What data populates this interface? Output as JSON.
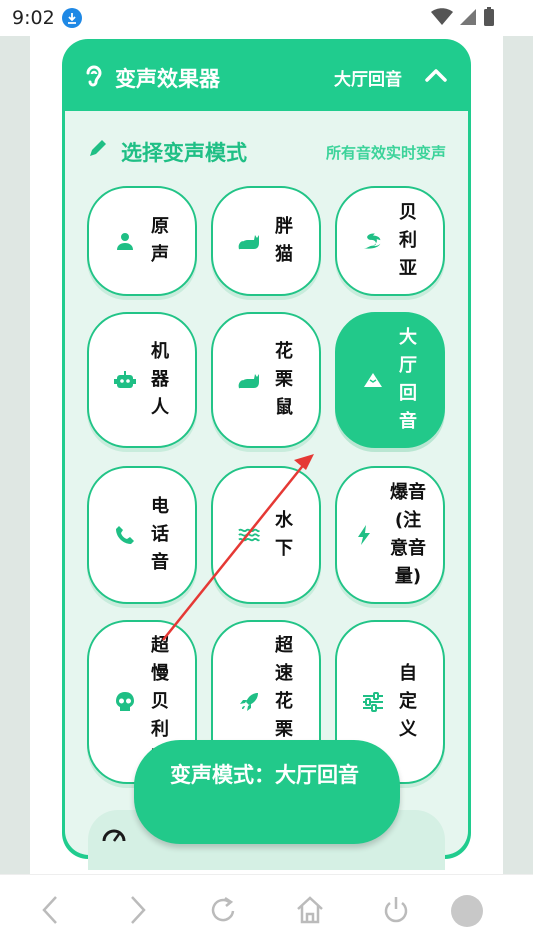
{
  "status_bar": {
    "time": "9:02"
  },
  "header": {
    "title": "变声效果器",
    "current_mode": "大厅回音"
  },
  "section": {
    "title": "选择变声模式",
    "note": "所有音效实时变声"
  },
  "tiles": [
    {
      "label": "原声",
      "icon": "person-icon",
      "active": false
    },
    {
      "label": "胖猫",
      "icon": "cat-icon",
      "active": false
    },
    {
      "label": "贝利亚",
      "icon": "dragon-icon",
      "active": false
    },
    {
      "label": "机器人",
      "icon": "robot-icon",
      "active": false
    },
    {
      "label": "花栗鼠",
      "icon": "cat-icon",
      "active": false
    },
    {
      "label": "大厅回音",
      "icon": "mountain-icon",
      "active": true
    },
    {
      "label": "电话音",
      "icon": "phone-icon",
      "active": false
    },
    {
      "label": "水下",
      "icon": "water-icon",
      "active": false
    },
    {
      "label": "爆音(注意音量)",
      "icon": "bolt-icon",
      "active": false
    },
    {
      "label": "超慢贝利亚",
      "icon": "skull-icon",
      "active": false
    },
    {
      "label": "超速花栗鼠",
      "icon": "rocket-icon",
      "active": false
    },
    {
      "label": "自定义",
      "icon": "sliders-icon",
      "active": false
    }
  ],
  "toast": {
    "text": "变声模式：大厅回音"
  },
  "colors": {
    "accent": "#22c98a",
    "panel_bg": "#e6f6ef",
    "annotation_arrow": "#e53935"
  }
}
